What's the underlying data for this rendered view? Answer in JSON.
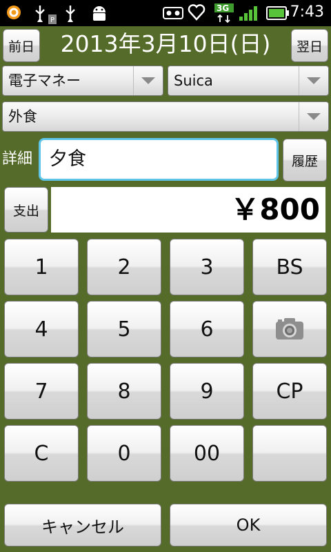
{
  "status_bar": {
    "time": "7:43",
    "network": "3G"
  },
  "header": {
    "prev_label": "前日",
    "date": "2013年3月10日(日)",
    "next_label": "翌日"
  },
  "selects": {
    "payment_method": "電子マネー",
    "payment_card": "Suica",
    "category": "外食"
  },
  "detail": {
    "label": "詳細",
    "value": "夕食",
    "history_label": "履歴"
  },
  "amount": {
    "type_label": "支出",
    "value": "￥800"
  },
  "keypad": {
    "k1": "1",
    "k2": "2",
    "k3": "3",
    "bs": "BS",
    "k4": "4",
    "k5": "5",
    "k6": "6",
    "k7": "7",
    "k8": "8",
    "k9": "9",
    "cp": "CP",
    "c": "C",
    "k0": "0",
    "k00": "00",
    "blank": ""
  },
  "footer": {
    "cancel_label": "キャンセル",
    "ok_label": "OK"
  }
}
